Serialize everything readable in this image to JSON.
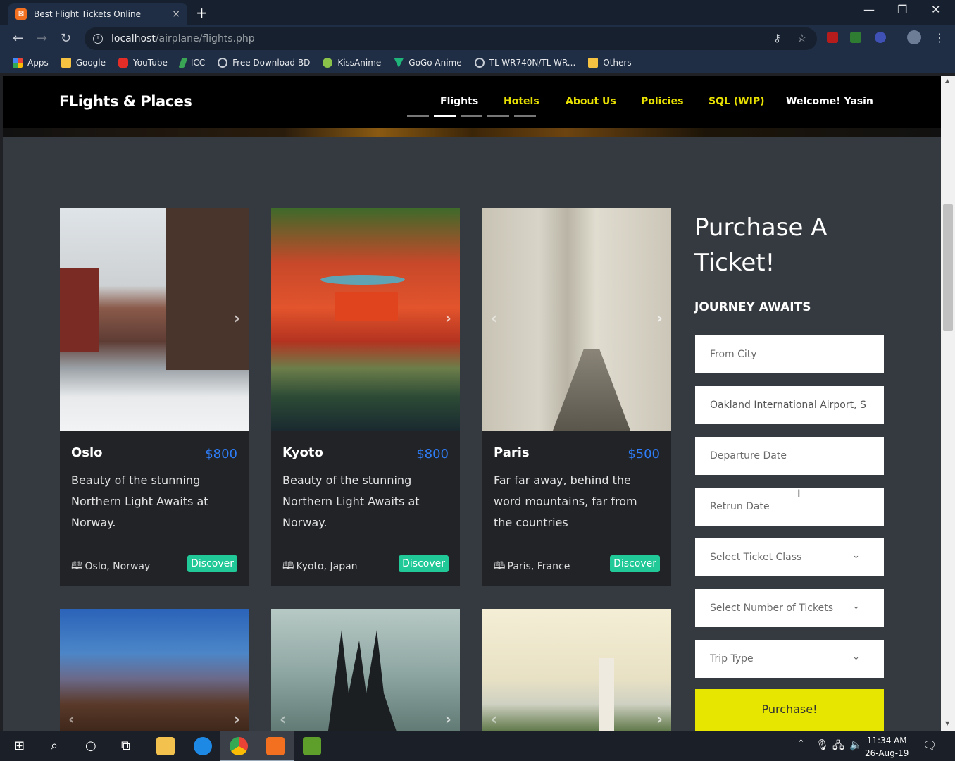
{
  "browser": {
    "tab_title": "Best Flight Tickets Online",
    "tab_close": "×",
    "new_tab": "+",
    "url_host": "localhost",
    "url_path": "/airplane/flights.php",
    "bookmarks": [
      {
        "label": "Apps",
        "icon": "apps-grid-icon",
        "color": "#ea4335"
      },
      {
        "label": "Google",
        "icon": "folder-icon",
        "color": "#f5c242"
      },
      {
        "label": "YouTube",
        "icon": "youtube-icon",
        "color": "#e52d27"
      },
      {
        "label": "ICC",
        "icon": "icc-icon",
        "color": "#3aa655"
      },
      {
        "label": "Free Download BD",
        "icon": "globe-icon",
        "color": "#c9ced6"
      },
      {
        "label": "KissAnime",
        "icon": "kissanime-icon",
        "color": "#8bc34a"
      },
      {
        "label": "GoGo Anime",
        "icon": "gogoanime-icon",
        "color": "#1fb57a"
      },
      {
        "label": "TL-WR740N/TL-WR...",
        "icon": "globe-icon",
        "color": "#c9ced6"
      },
      {
        "label": "Others",
        "icon": "folder-icon",
        "color": "#f5c242"
      }
    ]
  },
  "site": {
    "brand": "FLights & Places",
    "nav": [
      {
        "label": "Flights",
        "active": true
      },
      {
        "label": "Hotels",
        "active": false
      },
      {
        "label": "About Us",
        "active": false
      },
      {
        "label": "Policies",
        "active": false
      },
      {
        "label": "SQL (WIP)",
        "active": false
      },
      {
        "label": "Welcome! Yasin",
        "active": false
      }
    ],
    "accent_yellow": "#e8e000",
    "price_blue": "#2e7cf6",
    "discover_green": "#20c997"
  },
  "cards": [
    {
      "city": "Oslo",
      "price": "$800",
      "desc": "Beauty of the stunning Northern Light Awaits at Norway.",
      "location": "Oslo, Norway",
      "button": "Discover"
    },
    {
      "city": "Kyoto",
      "price": "$800",
      "desc": "Beauty of the stunning Northern Light Awaits at Norway.",
      "location": "Kyoto, Japan",
      "button": "Discover"
    },
    {
      "city": "Paris",
      "price": "$500",
      "desc": "Far far away, behind the word mountains, far from the countries",
      "location": "Paris, France",
      "button": "Discover"
    }
  ],
  "purchase": {
    "title": "Purchase A Ticket!",
    "subtitle": "JOURNEY AWAITS",
    "from_placeholder": "From City",
    "to_value": "Oakland International Airport, S",
    "departure_placeholder": "Departure Date",
    "return_placeholder": "Retrun Date",
    "ticket_class": "Select Ticket Class",
    "ticket_count": "Select Number of Tickets",
    "trip_type": "Trip Type",
    "button": "Purchase!"
  },
  "taskbar": {
    "time": "11:34 AM",
    "date": "26-Aug-19"
  }
}
